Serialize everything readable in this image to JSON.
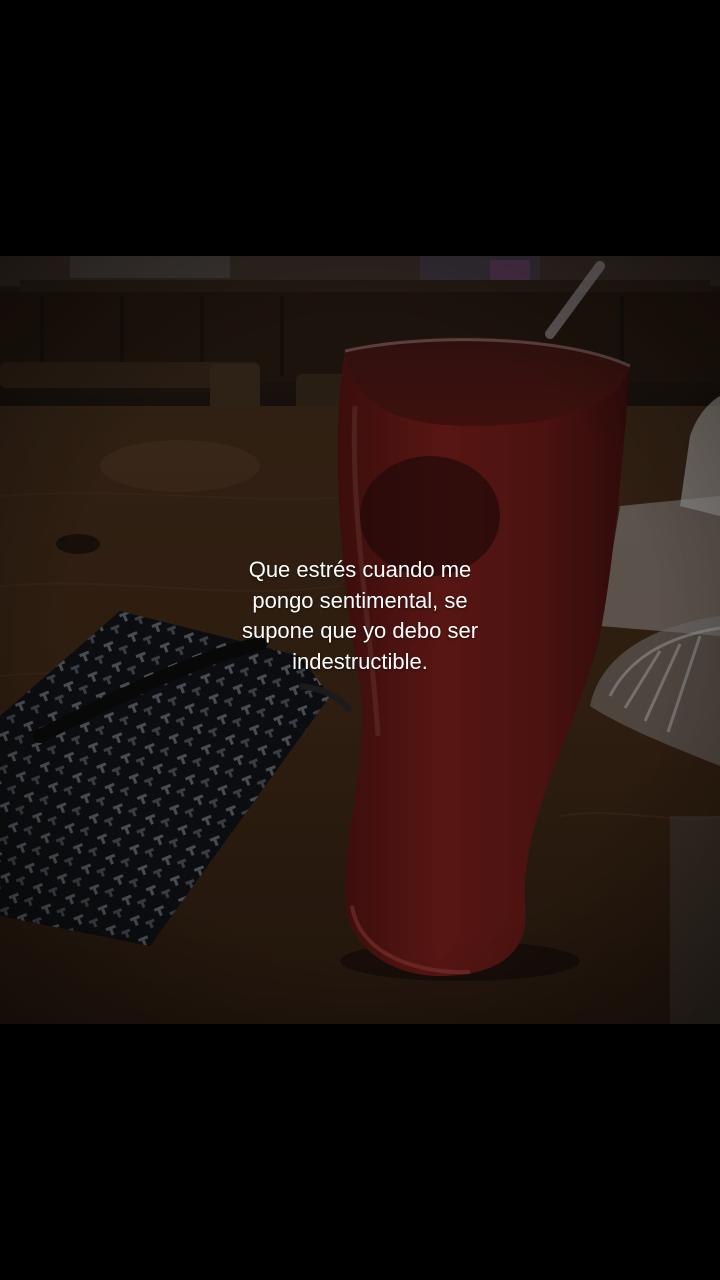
{
  "caption": {
    "lines": [
      "Que estrés cuando me",
      "pongo sentimental, se",
      "supone que yo debo ser",
      "indestructible."
    ]
  },
  "photo": {
    "subject": "red-drink-glass-on-wooden-table-with-patterned-pouch"
  },
  "colors": {
    "background": "#000000",
    "caption_text": "#ffffff",
    "table_wood": "#3a2616",
    "drink_red": "#6b1a16"
  }
}
